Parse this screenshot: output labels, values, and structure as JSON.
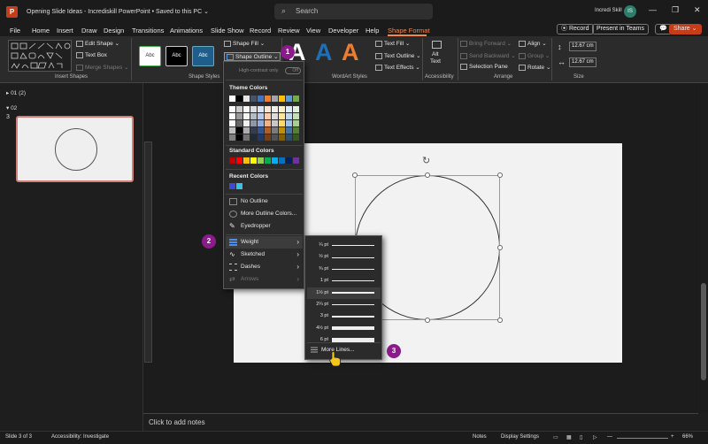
{
  "titlebar": {
    "app_letter": "P",
    "title": "Opening Slide Ideas - Incrediskill PowerPoint • Saved to this PC ⌄",
    "search_placeholder": "Search",
    "user_name": "Incredi Skill",
    "user_initials": "IS",
    "minimize": "—",
    "maximize": "❐",
    "close": "✕"
  },
  "tabs": [
    "File",
    "Home",
    "Insert",
    "Draw",
    "Design",
    "Transitions",
    "Animations",
    "Slide Show",
    "Record",
    "Review",
    "View",
    "Developer",
    "Help",
    "Shape Format"
  ],
  "header_buttons": {
    "record": "⦿ Record",
    "present_teams": "Present in Teams",
    "comment_icon": "💬",
    "share": "Share ⌄"
  },
  "ribbon": {
    "insert_shapes": {
      "label": "Insert Shapes",
      "edit_shape": "Edit Shape ⌄",
      "text_box": "Text Box",
      "merge_shapes": "Merge Shapes ⌄"
    },
    "shape_styles": {
      "label": "Shape Styles",
      "styles": [
        "Abc",
        "Abc",
        "Abc"
      ],
      "shape_fill": "Shape Fill ⌄",
      "shape_outline": "Shape Outline ⌄"
    },
    "wordart": {
      "label": "WordArt Styles",
      "letters": [
        "A",
        "A",
        "A"
      ],
      "text_fill": "Text Fill ⌄",
      "text_outline": "Text Outline ⌄",
      "text_effects": "Text Effects ⌄"
    },
    "accessibility": {
      "label": "Accessibility",
      "alt_text_line1": "Alt",
      "alt_text_line2": "Text"
    },
    "arrange": {
      "label": "Arrange",
      "bring_forward": "Bring Forward ⌄",
      "send_backward": "Send Backward ⌄",
      "selection_pane": "Selection Pane",
      "align": "Align ⌄",
      "group": "Group ⌄",
      "rotate": "Rotate ⌄"
    },
    "size": {
      "label": "Size",
      "height": "12.67 cm",
      "width": "12.67 cm"
    }
  },
  "slides_panel": {
    "section1": "▸ 01 (2)",
    "section2": "▾ 02",
    "slide_number": "3"
  },
  "notes_placeholder": "Click to add notes",
  "status": {
    "slide": "Slide 3 of 3",
    "accessibility": "Accessibility: Investigate",
    "notes": "Notes",
    "display_settings": "Display Settings",
    "zoom": "66%",
    "zoom_minus": "—",
    "zoom_plus": "+"
  },
  "outline_menu": {
    "high_contrast": "High-contrast only",
    "toggle": "Off",
    "theme_colors_header": "Theme Colors",
    "standard_colors_header": "Standard Colors",
    "recent_colors_header": "Recent Colors",
    "no_outline": "No Outline",
    "more_colors": "More Outline Colors...",
    "eyedropper": "Eyedropper",
    "weight": "Weight",
    "sketched": "Sketched",
    "dashes": "Dashes",
    "arrows": "Arrows",
    "theme_top_row": [
      "#ffffff",
      "#000000",
      "#e7e6e6",
      "#44546a",
      "#4472c4",
      "#ed7d31",
      "#a5a5a5",
      "#ffc000",
      "#5b9bd5",
      "#70ad47"
    ],
    "standard_colors": [
      "#c00000",
      "#ff0000",
      "#ffc000",
      "#ffff00",
      "#92d050",
      "#00b050",
      "#00b0f0",
      "#0070c0",
      "#002060",
      "#7030a0"
    ],
    "recent_colors": [
      "#3b4bd8",
      "#35c4e8"
    ]
  },
  "weight_menu": {
    "weights": [
      {
        "label": "¼ pt",
        "pt": 0.25
      },
      {
        "label": "½ pt",
        "pt": 0.5
      },
      {
        "label": "¾ pt",
        "pt": 0.75
      },
      {
        "label": "1 pt",
        "pt": 1
      },
      {
        "label": "1½ pt",
        "pt": 1.5
      },
      {
        "label": "2¼ pt",
        "pt": 2.25
      },
      {
        "label": "3 pt",
        "pt": 3
      },
      {
        "label": "4½ pt",
        "pt": 4.5
      },
      {
        "label": "6 pt",
        "pt": 6
      }
    ],
    "selected": "1½ pt",
    "more_lines": "More Lines..."
  },
  "callouts": [
    "1",
    "2",
    "3"
  ]
}
